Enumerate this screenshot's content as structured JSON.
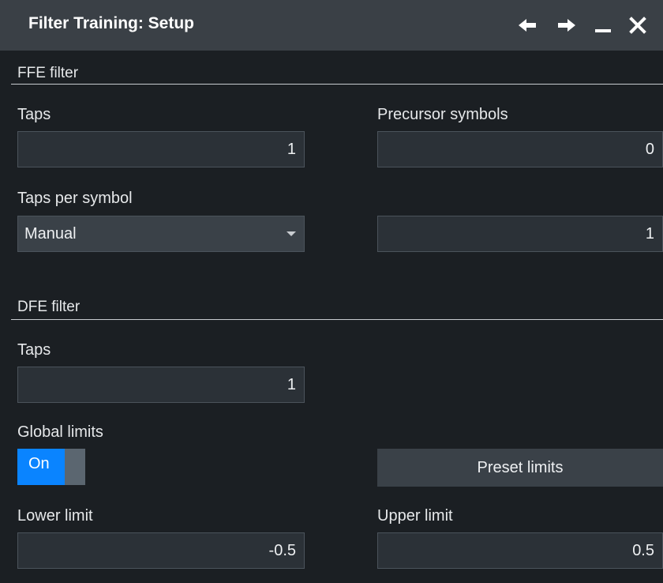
{
  "window": {
    "title": "Filter Training: Setup"
  },
  "ffe": {
    "section_title": "FFE filter",
    "taps_label": "Taps",
    "taps_value": "1",
    "precursor_label": "Precursor symbols",
    "precursor_value": "0",
    "taps_per_symbol_label": "Taps per symbol",
    "taps_per_symbol_mode": "Manual",
    "taps_per_symbol_value": "1"
  },
  "dfe": {
    "section_title": "DFE filter",
    "taps_label": "Taps",
    "taps_value": "1",
    "global_limits_label": "Global limits",
    "global_limits_state": "On",
    "preset_button": "Preset limits",
    "lower_label": "Lower limit",
    "lower_value": "-0.5",
    "upper_label": "Upper limit",
    "upper_value": "0.5"
  },
  "colors": {
    "titlebar": "#3a4046",
    "background": "#1b1f23",
    "accent": "#0a84ff"
  },
  "icons": [
    "arrow-left-icon",
    "arrow-right-icon",
    "minimize-icon",
    "close-icon"
  ]
}
